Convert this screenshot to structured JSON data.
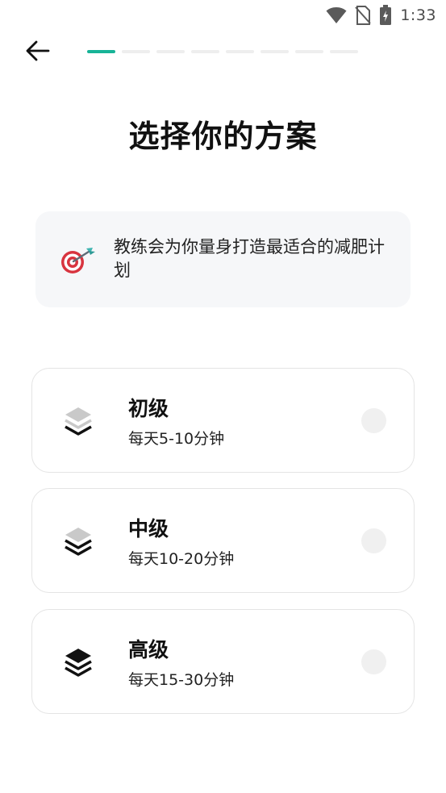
{
  "status_bar": {
    "time": "1:33",
    "icons": [
      "wifi-icon",
      "no-sim-icon",
      "battery-charging-icon"
    ]
  },
  "header": {
    "back_icon": "arrow-left-icon",
    "progress": {
      "total_steps": 8,
      "current_step": 1
    }
  },
  "page": {
    "title": "选择你的方案"
  },
  "info_card": {
    "icon": "target-dart-icon",
    "text": "教练会为你量身打造最适合的减肥计划"
  },
  "plans": [
    {
      "name": "初级",
      "duration": "每天5-10分钟",
      "icon": "layers-one-icon",
      "selected": false
    },
    {
      "name": "中级",
      "duration": "每天10-20分钟",
      "icon": "layers-two-icon",
      "selected": false
    },
    {
      "name": "高级",
      "duration": "每天15-30分钟",
      "icon": "layers-three-icon",
      "selected": false
    }
  ],
  "colors": {
    "accent": "#17b397",
    "progress_inactive": "#eeeeee",
    "card_bg": "#f6f7f9",
    "border": "#e4e4e4",
    "radio": "#f0f0f0"
  }
}
